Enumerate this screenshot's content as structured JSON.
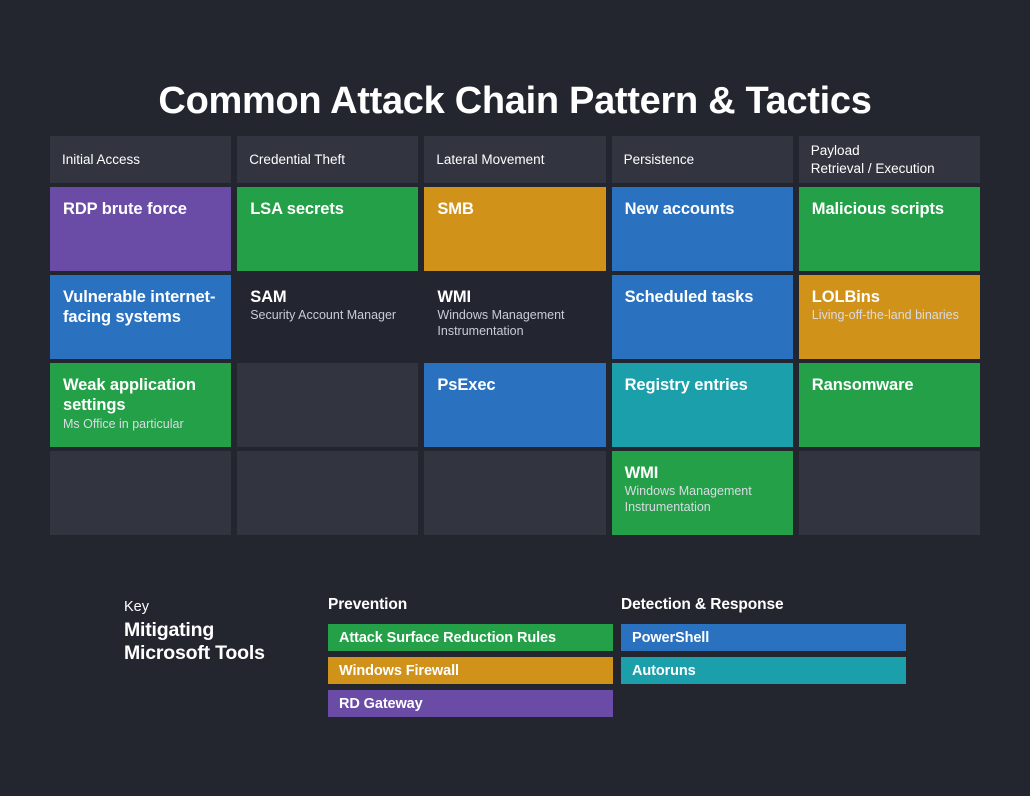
{
  "title": "Common Attack Chain Pattern & Tactics",
  "colors": {
    "background": "#24262f",
    "empty_cell": "#32343f",
    "purple": "#6a4ba5",
    "green": "#23a048",
    "orange": "#d09218",
    "blue": "#2a72bf",
    "teal": "#1a9fab"
  },
  "matrix": {
    "headers": [
      {
        "lines": [
          "Initial Access"
        ]
      },
      {
        "lines": [
          "Credential Theft"
        ]
      },
      {
        "lines": [
          "Lateral Movement"
        ]
      },
      {
        "lines": [
          "Persistence"
        ]
      },
      {
        "lines": [
          "Payload",
          "Retrieval / Execution"
        ]
      }
    ],
    "columns": [
      {
        "name": "Initial Access",
        "cells": [
          {
            "title": "RDP brute force",
            "sub": "",
            "color": "purple"
          },
          {
            "title": "Vulnerable internet-facing systems",
            "sub": "",
            "color": "blue"
          },
          {
            "title": "Weak application settings",
            "sub": "Ms Office in particular",
            "color": "green"
          },
          {
            "title": "",
            "sub": "",
            "color": "empty"
          }
        ]
      },
      {
        "name": "Credential Theft",
        "cells": [
          {
            "title": "LSA secrets",
            "sub": "",
            "color": "green"
          },
          {
            "title": "SAM",
            "sub": "Security Account Manager",
            "color": "plain"
          },
          {
            "title": "",
            "sub": "",
            "color": "empty"
          },
          {
            "title": "",
            "sub": "",
            "color": "empty"
          }
        ]
      },
      {
        "name": "Lateral Movement",
        "cells": [
          {
            "title": "SMB",
            "sub": "",
            "color": "orange"
          },
          {
            "title": "WMI",
            "sub": "Windows Management Instrumentation",
            "color": "plain"
          },
          {
            "title": "PsExec",
            "sub": "",
            "color": "blue"
          },
          {
            "title": "",
            "sub": "",
            "color": "empty"
          }
        ]
      },
      {
        "name": "Persistence",
        "cells": [
          {
            "title": "New accounts",
            "sub": "",
            "color": "blue"
          },
          {
            "title": "Scheduled tasks",
            "sub": "",
            "color": "blue"
          },
          {
            "title": "Registry entries",
            "sub": "",
            "color": "teal"
          },
          {
            "title": "WMI",
            "sub": "Windows Management Instrumentation",
            "color": "green"
          }
        ]
      },
      {
        "name": "Payload Retrieval / Execution",
        "cells": [
          {
            "title": "Malicious scripts",
            "sub": "",
            "color": "green"
          },
          {
            "title": "LOLBins",
            "sub": "Living-off-the-land binaries",
            "color": "orange"
          },
          {
            "title": "Ransomware",
            "sub": "",
            "color": "green"
          },
          {
            "title": "",
            "sub": "",
            "color": "empty"
          }
        ]
      }
    ]
  },
  "legend": {
    "key_label": "Key",
    "key_title": "Mitigating Microsoft Tools",
    "columns": [
      {
        "heading": "Prevention",
        "items": [
          {
            "label": "Attack Surface Reduction Rules",
            "color": "green"
          },
          {
            "label": "Windows Firewall",
            "color": "orange"
          },
          {
            "label": "RD Gateway",
            "color": "purple"
          }
        ]
      },
      {
        "heading": "Detection & Response",
        "items": [
          {
            "label": "PowerShell",
            "color": "blue"
          },
          {
            "label": "Autoruns",
            "color": "teal"
          }
        ]
      }
    ]
  }
}
